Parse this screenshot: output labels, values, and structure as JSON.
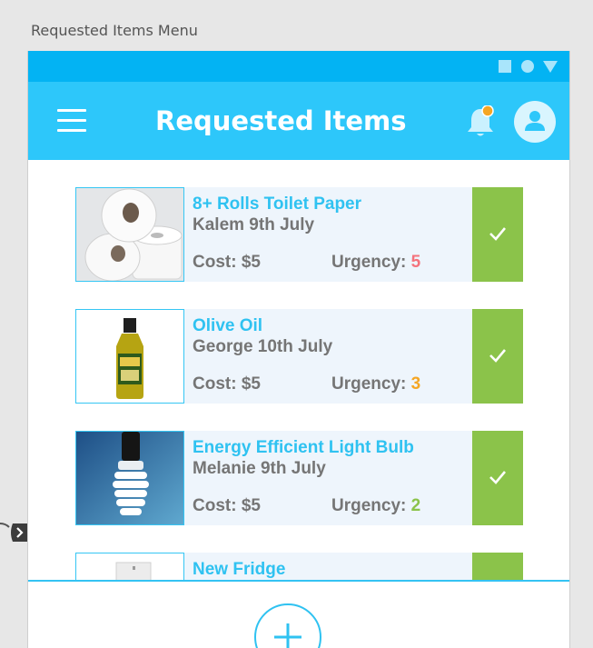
{
  "canvas": {
    "label": "Requested Items Menu"
  },
  "app_bar": {
    "title": "Requested Items"
  },
  "colors": {
    "status_bar": "#03b3f3",
    "app_bar": "#2dc7fa",
    "accent": "#2fc2f1",
    "approve_green": "#8bc34a",
    "urgency_red": "#f4727c",
    "urgency_orange": "#f5a623",
    "urgency_green": "#8bc34a",
    "notification_dot": "#f5a623"
  },
  "items": [
    {
      "name": "8+ Rolls Toilet Paper",
      "requester": "Kalem 9th July",
      "cost": "Cost: $5",
      "urgency_label": "Urgency:",
      "urgency_value": "5",
      "urgency_color": "#f4727c",
      "thumbnail": "toilet-paper-image",
      "action_icon": "check-icon"
    },
    {
      "name": "Olive Oil",
      "requester": "George 10th July",
      "cost": "Cost: $5",
      "urgency_label": "Urgency:",
      "urgency_value": "3",
      "urgency_color": "#f5a623",
      "thumbnail": "olive-oil-image",
      "action_icon": "check-icon"
    },
    {
      "name": "Energy Efficient Light Bulb",
      "requester": "Melanie 9th July",
      "cost": "Cost: $5",
      "urgency_label": "Urgency:",
      "urgency_value": "2",
      "urgency_color": "#8bc34a",
      "thumbnail": "light-bulb-image",
      "action_icon": "check-icon"
    },
    {
      "name": "New Fridge",
      "thumbnail": "fridge-image",
      "action_icon": "check-icon"
    }
  ],
  "icons": {
    "menu": "hamburger-menu-icon",
    "notifications": "bell-icon",
    "profile": "person-icon",
    "add": "plus-icon",
    "side_toggle": "chevron-right-icon"
  }
}
